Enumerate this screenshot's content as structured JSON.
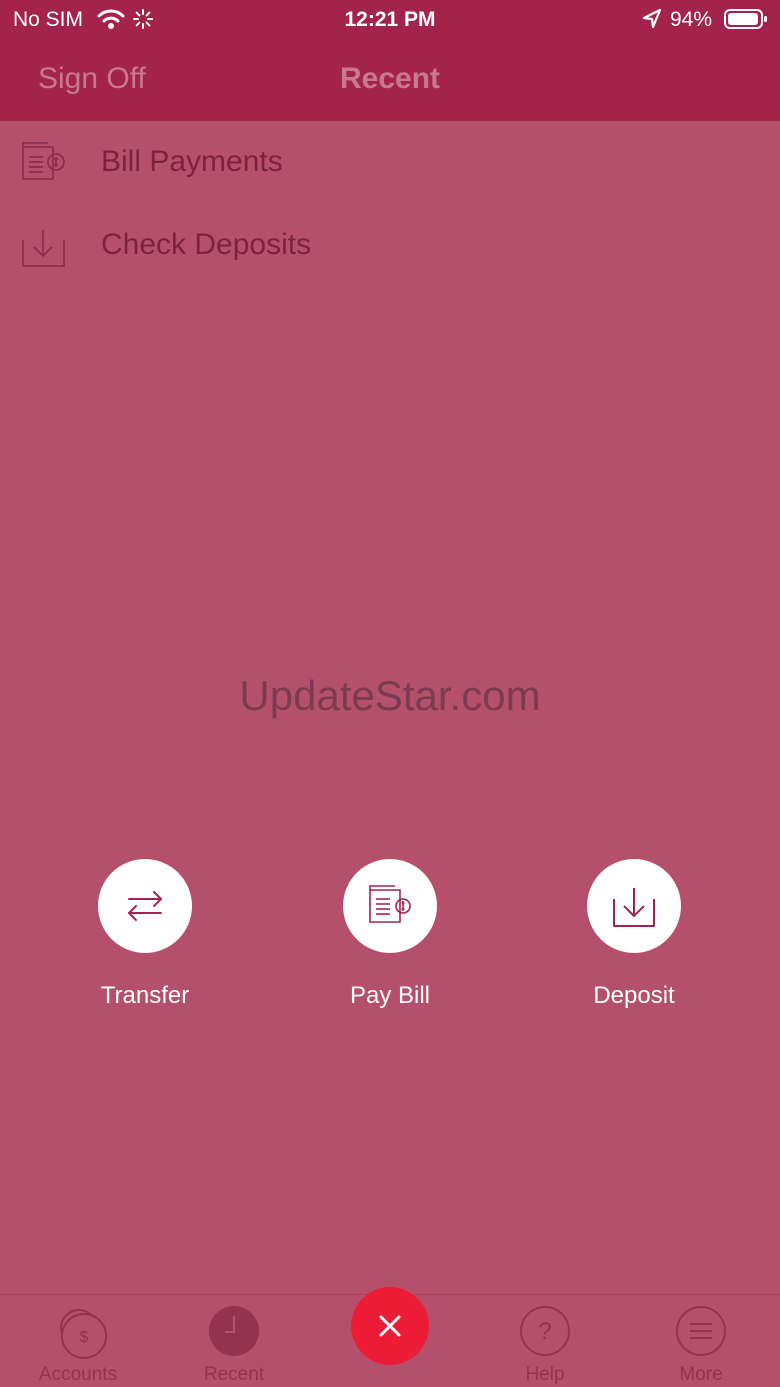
{
  "status_bar": {
    "carrier": "No SIM",
    "time": "12:21 PM",
    "battery": "94%"
  },
  "nav": {
    "left_button": "Sign Off",
    "title": "Recent"
  },
  "recent_items": [
    {
      "label": "Bill Payments",
      "icon": "bill-icon"
    },
    {
      "label": "Check Deposits",
      "icon": "deposit-icon"
    }
  ],
  "watermark": "UpdateStar.com",
  "actions": [
    {
      "label": "Transfer",
      "icon": "transfer-icon"
    },
    {
      "label": "Pay Bill",
      "icon": "bill-icon"
    },
    {
      "label": "Deposit",
      "icon": "deposit-icon"
    }
  ],
  "tabs": [
    {
      "label": "Accounts",
      "icon": "accounts-icon"
    },
    {
      "label": "Recent",
      "icon": "clock-icon"
    },
    {
      "label": "Help",
      "icon": "help-icon"
    },
    {
      "label": "More",
      "icon": "menu-icon"
    }
  ],
  "colors": {
    "header": "#a4234c",
    "overlay": "#b5506c",
    "close_button": "#ed1c36",
    "icon_accent": "#a4234c"
  }
}
